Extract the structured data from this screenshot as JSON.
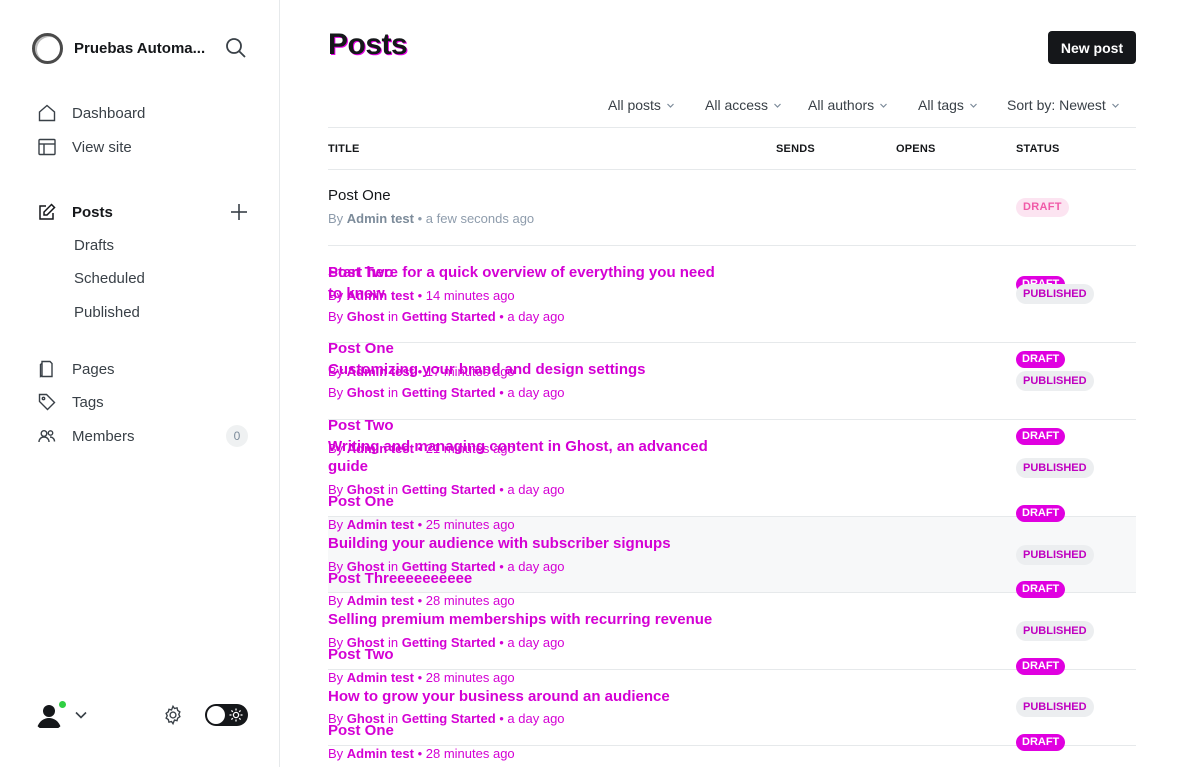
{
  "site": {
    "name": "Pruebas Automa..."
  },
  "nav": {
    "dashboard": "Dashboard",
    "view_site": "View site",
    "posts": "Posts",
    "drafts": "Drafts",
    "scheduled": "Scheduled",
    "published": "Published",
    "pages": "Pages",
    "tags": "Tags",
    "members": "Members",
    "members_count": "0"
  },
  "header": {
    "title": "Posts",
    "new_post": "New post"
  },
  "filters": {
    "posts": "All posts",
    "access": "All access",
    "authors": "All authors",
    "tags": "All tags",
    "sort": "Sort by: Newest"
  },
  "columns": {
    "title": "TITLE",
    "sends": "SENDS",
    "opens": "OPENS",
    "status": "STATUS"
  },
  "first_row": {
    "title": "Post One",
    "by": "By",
    "author": "Admin test",
    "time": "• a few seconds ago",
    "status": "DRAFT"
  },
  "overlap_posts": [
    {
      "title": "Post Two",
      "author": "Admin test",
      "time": "• 14 minutes ago",
      "status": "DRAFT"
    },
    {
      "title": "Post One",
      "author": "Admin test",
      "time": "• 17 minutes ago",
      "status": "DRAFT"
    },
    {
      "title": "Post Two",
      "author": "Admin test",
      "time": "• 21 minutes ago",
      "status": "DRAFT"
    },
    {
      "title": "Post One",
      "author": "Admin test",
      "time": "• 25 minutes ago",
      "status": "DRAFT"
    },
    {
      "title": "Post Threeeeeeeeee",
      "author": "Admin test",
      "time": "• 28 minutes ago",
      "status": "DRAFT"
    },
    {
      "title": "Post Two",
      "author": "Admin test",
      "time": "• 28 minutes ago",
      "status": "DRAFT"
    },
    {
      "title": "Post One",
      "author": "Admin test",
      "time": "• 28 minutes ago",
      "status": "DRAFT"
    }
  ],
  "ghost_posts": [
    {
      "title": "Start here for a quick overview of everything you need",
      "title2": "to know",
      "meta_by": "By",
      "meta_author": "Ghost",
      "meta_in": "in",
      "meta_tag": "Getting Started",
      "meta_time": "• a day ago",
      "status": "PUBLISHED"
    },
    {
      "title": "Customizing your brand and design settings",
      "meta_by": "By",
      "meta_author": "Ghost",
      "meta_in": "in",
      "meta_tag": "Getting Started",
      "meta_time": "• a day ago",
      "status": "PUBLISHED"
    },
    {
      "title": "Writing and managing content in Ghost, an advanced",
      "title2": "guide",
      "meta_by": "By",
      "meta_author": "Ghost",
      "meta_in": "in",
      "meta_tag": "Getting Started",
      "meta_time": "• a day ago",
      "status": "PUBLISHED"
    },
    {
      "title": "Building your audience with subscriber signups",
      "meta_by": "By",
      "meta_author": "Ghost",
      "meta_in": "in",
      "meta_tag": "Getting Started",
      "meta_time": "• a day ago",
      "status": "PUBLISHED"
    },
    {
      "title": "Selling premium memberships with recurring revenue",
      "meta_by": "By",
      "meta_author": "Ghost",
      "meta_in": "in",
      "meta_tag": "Getting Started",
      "meta_time": "• a day ago",
      "status": "PUBLISHED"
    },
    {
      "title": "How to grow your business around an audience",
      "meta_by": "By",
      "meta_author": "Ghost",
      "meta_in": "in",
      "meta_tag": "Getting Started",
      "meta_time": "• a day ago",
      "status": "PUBLISHED"
    }
  ],
  "colors": {
    "accent": "#15171a",
    "draft_bg": "#fce4f1",
    "draft_text": "#f05aa8",
    "glitch": "#d400d4",
    "online": "#30cf43"
  },
  "icons": [
    "search-icon",
    "home-icon",
    "view-site-icon",
    "edit-icon",
    "plus-icon",
    "pages-icon",
    "tag-icon",
    "members-icon",
    "chevron-down-icon",
    "gear-icon",
    "sun-icon",
    "avatar-icon"
  ]
}
